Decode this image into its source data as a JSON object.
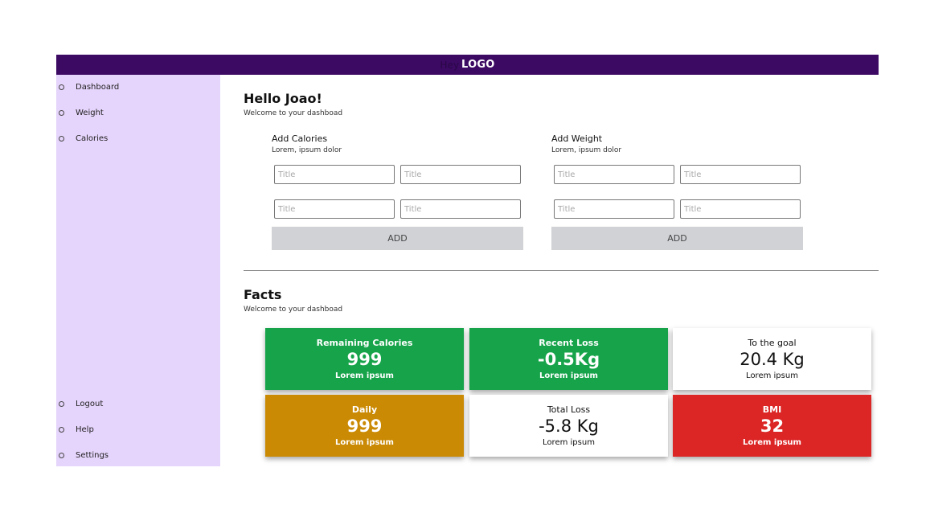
{
  "header": {
    "brand_prefix": "Hey",
    "logo": "LOGO",
    "bar_color": "#3c0a63"
  },
  "sidebar": {
    "background": "#e5d4fb",
    "top_items": [
      {
        "label": "Dashboard",
        "icon": "circle-icon"
      },
      {
        "label": "Weight",
        "icon": "circle-icon"
      },
      {
        "label": "Calories",
        "icon": "circle-icon"
      }
    ],
    "bottom_items": [
      {
        "label": "Logout",
        "icon": "circle-icon"
      },
      {
        "label": "Help",
        "icon": "circle-icon"
      },
      {
        "label": "Settings",
        "icon": "circle-icon"
      }
    ]
  },
  "main": {
    "greeting": "Hello Joao!",
    "greeting_subtitle": "Welcome to your dashboad",
    "add_calories": {
      "title": "Add Calories",
      "subtitle": "Lorem, ipsum dolor",
      "fields": [
        {
          "placeholder": "Title",
          "value": ""
        },
        {
          "placeholder": "Title",
          "value": ""
        },
        {
          "placeholder": "Title",
          "value": ""
        },
        {
          "placeholder": "Title",
          "value": ""
        }
      ],
      "button_label": "ADD"
    },
    "add_weight": {
      "title": "Add Weight",
      "subtitle": "Lorem, ipsum dolor",
      "fields": [
        {
          "placeholder": "Title",
          "value": ""
        },
        {
          "placeholder": "Title",
          "value": ""
        },
        {
          "placeholder": "Title",
          "value": ""
        },
        {
          "placeholder": "Title",
          "value": ""
        }
      ],
      "button_label": "ADD"
    },
    "facts": {
      "title": "Facts",
      "subtitle": "Welcome to your dashboad",
      "cards": [
        {
          "label": "Remaining Calories",
          "value": "999",
          "sub": "Lorem ipsum",
          "color": "#16a34a"
        },
        {
          "label": "Recent Loss",
          "value": "-0.5Kg",
          "sub": "Lorem ipsum",
          "color": "#16a34a"
        },
        {
          "label": "To the goal",
          "value": "20.4 Kg",
          "sub": "Lorem ipsum",
          "color": "#ffffff"
        },
        {
          "label": "Daily",
          "value": "999",
          "sub": "Lorem ipsum",
          "color": "#ca8a04"
        },
        {
          "label": "Total Loss",
          "value": "-5.8 Kg",
          "sub": "Lorem ipsum",
          "color": "#ffffff"
        },
        {
          "label": "BMI",
          "value": "32",
          "sub": "Lorem ipsum",
          "color": "#dc2626"
        }
      ]
    }
  }
}
